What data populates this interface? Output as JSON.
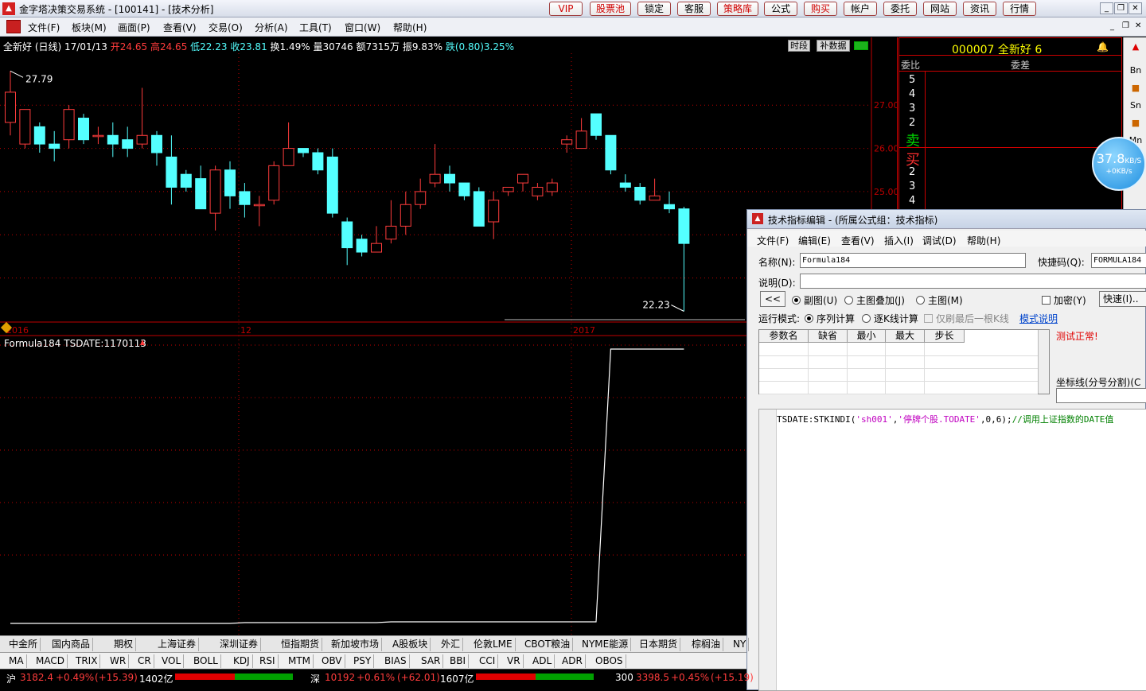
{
  "window": {
    "title": "金字塔决策交易系统 - [100141] - [技术分析]",
    "app_icon": "pyramid-app-icon"
  },
  "top_buttons": [
    "VIP",
    "股票池",
    "锁定",
    "客服",
    "策略库",
    "公式",
    "购买",
    "帐户",
    "委托",
    "网站",
    "资讯",
    "行情"
  ],
  "top_buttons_red": [
    "VIP",
    "股票池",
    "策略库",
    "购买"
  ],
  "menu": [
    "文件(F)",
    "板块(M)",
    "画面(P)",
    "查看(V)",
    "交易(O)",
    "分析(A)",
    "工具(T)",
    "窗口(W)",
    "帮助(H)"
  ],
  "info": {
    "name": "全新好",
    "period": "(日线)",
    "date": "17/01/13",
    "open_lbl": "开24.65",
    "high_lbl": "高24.65",
    "low_lbl": "低22.23",
    "close_lbl": "收23.81",
    "turnover": "换1.49%",
    "volume": "量30746",
    "amount": "额7315万",
    "amplitude": "振9.83%",
    "change": "跌(0.80)3.25%"
  },
  "tag_buttons": [
    "时段",
    "补数据"
  ],
  "price_axis": [
    "27.00",
    "26.00",
    "25.00"
  ],
  "price_markers": {
    "high": "27.79",
    "low": "22.23"
  },
  "date_axis": [
    "2016",
    "12",
    "2017"
  ],
  "indicator": {
    "label": "Formula184 TSDATE:1170113"
  },
  "chart_data": {
    "type": "candlestick",
    "ylim": [
      22.0,
      28.2
    ],
    "candles": [
      {
        "o": 26.6,
        "c": 27.3,
        "h": 27.79,
        "l": 26.3
      },
      {
        "o": 26.1,
        "c": 26.9,
        "h": 26.9,
        "l": 26.0
      },
      {
        "o": 26.5,
        "c": 26.1,
        "h": 26.6,
        "l": 25.9
      },
      {
        "o": 26.1,
        "c": 26.0,
        "h": 26.4,
        "l": 25.7
      },
      {
        "o": 26.2,
        "c": 26.9,
        "h": 27.0,
        "l": 26.0
      },
      {
        "o": 26.7,
        "c": 26.2,
        "h": 26.8,
        "l": 26.1
      },
      {
        "o": 26.3,
        "c": 26.3,
        "h": 26.5,
        "l": 26.1
      },
      {
        "o": 26.3,
        "c": 26.1,
        "h": 26.6,
        "l": 25.8
      },
      {
        "o": 26.2,
        "c": 26.0,
        "h": 26.5,
        "l": 25.8
      },
      {
        "o": 26.1,
        "c": 26.3,
        "h": 27.4,
        "l": 26.0
      },
      {
        "o": 26.3,
        "c": 25.9,
        "h": 26.4,
        "l": 25.6
      },
      {
        "o": 25.8,
        "c": 25.1,
        "h": 26.3,
        "l": 24.7
      },
      {
        "o": 25.4,
        "c": 25.1,
        "h": 25.5,
        "l": 25.0
      },
      {
        "o": 25.3,
        "c": 24.6,
        "h": 25.6,
        "l": 24.6
      },
      {
        "o": 24.5,
        "c": 25.5,
        "h": 25.6,
        "l": 24.1
      },
      {
        "o": 25.5,
        "c": 24.9,
        "h": 25.7,
        "l": 24.6
      },
      {
        "o": 25.0,
        "c": 24.7,
        "h": 25.2,
        "l": 24.4
      },
      {
        "o": 24.7,
        "c": 24.7,
        "h": 24.9,
        "l": 24.2
      },
      {
        "o": 24.8,
        "c": 25.6,
        "h": 25.7,
        "l": 24.7
      },
      {
        "o": 25.6,
        "c": 26.0,
        "h": 26.6,
        "l": 25.6
      },
      {
        "o": 26.0,
        "c": 25.9,
        "h": 26.0,
        "l": 25.8
      },
      {
        "o": 25.9,
        "c": 25.5,
        "h": 26.0,
        "l": 25.4
      },
      {
        "o": 25.8,
        "c": 24.5,
        "h": 26.0,
        "l": 24.4
      },
      {
        "o": 24.3,
        "c": 23.7,
        "h": 24.4,
        "l": 23.3
      },
      {
        "o": 23.9,
        "c": 23.6,
        "h": 24.0,
        "l": 23.5
      },
      {
        "o": 23.6,
        "c": 23.8,
        "h": 24.2,
        "l": 23.6
      },
      {
        "o": 23.9,
        "c": 24.2,
        "h": 24.8,
        "l": 23.8
      },
      {
        "o": 24.2,
        "c": 24.7,
        "h": 25.0,
        "l": 24.0
      },
      {
        "o": 24.7,
        "c": 25.0,
        "h": 25.3,
        "l": 24.6
      },
      {
        "o": 25.2,
        "c": 25.4,
        "h": 26.1,
        "l": 25.1
      },
      {
        "o": 25.4,
        "c": 25.2,
        "h": 25.6,
        "l": 25.0
      },
      {
        "o": 25.2,
        "c": 24.9,
        "h": 25.2,
        "l": 24.8
      },
      {
        "o": 25.0,
        "c": 24.2,
        "h": 25.1,
        "l": 24.2
      },
      {
        "o": 24.3,
        "c": 24.8,
        "h": 25.0,
        "l": 23.9
      },
      {
        "o": 25.0,
        "c": 25.1,
        "h": 25.1,
        "l": 24.9
      },
      {
        "o": 25.2,
        "c": 25.4,
        "h": 25.4,
        "l": 25.0
      },
      {
        "o": 24.9,
        "c": 25.1,
        "h": 25.2,
        "l": 24.8
      },
      {
        "o": 25.0,
        "c": 25.2,
        "h": 25.3,
        "l": 24.9
      },
      {
        "o": 26.1,
        "c": 26.2,
        "h": 26.3,
        "l": 25.9
      },
      {
        "o": 26.0,
        "c": 26.4,
        "h": 26.7,
        "l": 26.0
      },
      {
        "o": 26.8,
        "c": 26.3,
        "h": 26.8,
        "l": 26.2
      },
      {
        "o": 26.3,
        "c": 25.5,
        "h": 26.3,
        "l": 25.4
      },
      {
        "o": 25.2,
        "c": 25.1,
        "h": 25.4,
        "l": 25.0
      },
      {
        "o": 25.1,
        "c": 24.8,
        "h": 25.2,
        "l": 24.7
      },
      {
        "o": 24.8,
        "c": 24.9,
        "h": 25.3,
        "l": 24.8
      },
      {
        "o": 24.7,
        "c": 24.6,
        "h": 25.0,
        "l": 24.5
      },
      {
        "o": 24.6,
        "c": 23.8,
        "h": 24.65,
        "l": 22.23
      }
    ],
    "indicator_series": {
      "name": "TSDATE",
      "step_index": 40,
      "before": 1161200,
      "after": 1170113
    }
  },
  "right_panel": {
    "code": "000007",
    "name": "全新好",
    "num": "6",
    "weibi": "委比",
    "weicha": "委差",
    "sell_levels": [
      "5",
      "4",
      "3",
      "2"
    ],
    "sell_label": "卖",
    "buy_label": "买",
    "buy_levels": [
      "2",
      "3",
      "4"
    ]
  },
  "right_toolbar": [
    "Bn",
    "Sn",
    "Mn"
  ],
  "net_widget": {
    "speed": "37.8",
    "unit": "KB/S",
    "sub": "+0KB/s"
  },
  "editor": {
    "title": "技术指标编辑 - (所属公式组：技术指标)",
    "menu": [
      "文件(F)",
      "编辑(E)",
      "查看(V)",
      "插入(I)",
      "调试(D)",
      "帮助(H)"
    ],
    "name_label": "名称(N):",
    "name_value": "Formula184",
    "shortcut_label": "快捷码(Q):",
    "shortcut_value": "FORMULA184",
    "desc_label": "说明(D):",
    "desc_value": "",
    "back_btn": "<<",
    "radio_sub": "副图(U)",
    "radio_overlay": "主图叠加(J)",
    "radio_main": "主图(M)",
    "encrypt": "加密(Y)",
    "quick_btn": "快速(I)..",
    "run_mode_label": "运行模式:",
    "mode_seq": "序列计算",
    "mode_each": "逐K线计算",
    "last_bar_only": "仅刷最后一根K线",
    "mode_help": "模式说明",
    "param_cols": [
      "参数名",
      "缺省",
      "最小",
      "最大",
      "步长"
    ],
    "test_status": "测试正常!",
    "coord_label": "坐标线(分号分割)(C",
    "code_prefix": "TSDATE:STKINDI(",
    "code_arg1": "'sh001'",
    "code_comma": ",",
    "code_arg2": "'停牌个股.TODATE'",
    "code_rest": ",0,6);",
    "code_comment": "//调用上证指数的DATE值"
  },
  "tabs_row1": [
    "中金所",
    "国内商品",
    "期权",
    "上海证券",
    "深圳证券",
    "恒指期货",
    "新加坡市场",
    "A股板块",
    "外汇",
    "伦敦LME",
    "CBOT粮油",
    "NYME能源",
    "日本期货",
    "棕榈油",
    "NY"
  ],
  "tabs_row2": [
    "MA",
    "MACD",
    "TRIX",
    "WR",
    "CR",
    "VOL",
    "BOLL",
    "KDJ",
    "RSI",
    "MTM",
    "OBV",
    "PSY",
    "BIAS",
    "SAR",
    "BBI",
    "CCI",
    "VR",
    "ADL",
    "ADR",
    "OBOS"
  ],
  "status": {
    "sh_label": "沪",
    "sh_index": "3182.4",
    "sh_pct": "+0.49%",
    "sh_chg": "(+15.39)",
    "sh_amt": "1402亿",
    "sz_label": "深",
    "sz_index": "10192",
    "sz_pct": "+0.61%",
    "sz_chg": "(+62.01)",
    "sz_amt": "1607亿",
    "h300_label": "300",
    "h300_index": "3398.5",
    "h300_pct": "+0.45%",
    "h300_chg": "(+15.19)"
  },
  "colors": {
    "up": "#ff3c3c",
    "down": "#54ffff",
    "axis": "#c00000",
    "text_white": "#ffffff",
    "indicator_line": "#ffffff"
  }
}
